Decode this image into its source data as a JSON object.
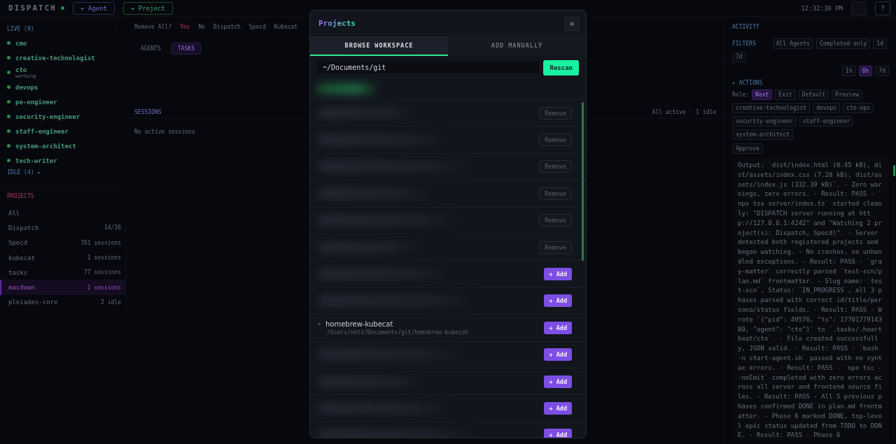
{
  "topbar": {
    "logo": "DISPATCH",
    "buttons": [
      {
        "label": "+ Agent",
        "kind": "agent"
      },
      {
        "label": "+ Project",
        "kind": "project"
      }
    ],
    "clock": "12:32:38 PM",
    "help": "?"
  },
  "sidebar": {
    "live_header": "LIVE (9)",
    "agents": [
      {
        "name": "cmo"
      },
      {
        "name": "creative-technologist"
      },
      {
        "name": "cto",
        "status": "working"
      },
      {
        "name": "devops"
      },
      {
        "name": "pe-engineer"
      },
      {
        "name": "security-engineer"
      },
      {
        "name": "staff-engineer"
      },
      {
        "name": "system-architect"
      },
      {
        "name": "tech-writer"
      }
    ],
    "idle_toggle": "IDLE (4) ▸",
    "projects_header": "PROJECTS",
    "projects": [
      {
        "name": "All",
        "selected": false
      },
      {
        "name": "Dispatch",
        "meta": "14/36",
        "selected": false
      },
      {
        "name": "Specd",
        "meta": "761 sessions",
        "selected": false
      },
      {
        "name": "kubecat",
        "meta": "1 sessions",
        "selected": false
      },
      {
        "name": "tasks",
        "meta": "77 sessions",
        "selected": false
      },
      {
        "name": "macdown",
        "meta": "1 sessions",
        "selected": true
      },
      {
        "name": "pleiades-core",
        "meta": "2 idle",
        "selected": false
      }
    ]
  },
  "center": {
    "filter_bar": {
      "prompt": "Remove All?",
      "confirm": "Yes",
      "cancel": "No",
      "projects": [
        "Dispatch",
        "Specd",
        "Kubecat"
      ]
    },
    "view_tabs": [
      {
        "label": "AGENTS",
        "selected": false
      },
      {
        "label": "TASKS",
        "selected": true
      }
    ],
    "sessions": {
      "title": "SESSIONS",
      "summary": "All active · 1 idle",
      "empty": "No active sessions"
    }
  },
  "activity": {
    "title": "ACTIVITY",
    "filters_label": "FILTERS",
    "filter_chips": [
      "All Agents",
      "Completed only",
      "1d",
      "7d"
    ],
    "ranges": [
      {
        "label": "1h",
        "selected": false
      },
      {
        "label": "6h",
        "selected": true
      },
      {
        "label": "7d",
        "selected": false
      }
    ],
    "actions_label": "▸ ACTIONS",
    "role_label": "Role:",
    "roles": [
      {
        "label": "Next",
        "selected": true
      },
      {
        "label": "Exit",
        "selected": false
      },
      {
        "label": "Default",
        "selected": false
      },
      {
        "label": "Preview",
        "selected": false
      }
    ],
    "agent_chips": [
      "creative-technologist",
      "devops",
      "cto-ops",
      "security-engineer",
      "staff-engineer",
      "system-architect"
    ],
    "section": "Approve",
    "log": "Output: `dist/index.html (0.45 kB), dist/assets/index.css (7.28 kB), dist/assets/index.js (332.39 kB)`. - Zero warnings, zero errors. - Result: PASS - `npx tsx server/index.ts` started cleanly: \"DISPATCH server running at http://127.0.0.1:4242\" and \"Watching 2 project(s): Dispatch, Specd)\". - Server detected both registered projects and began watching. - No crashes, no unhandled exceptions. - Result: PASS - `gray-matter` correctly parsed `test-scn/plan.md` frontmatter. - Slug name: `test-scn`, Status: `IN_PROGRESS`, all 3 phases parsed with correct id/title/persona/status fields. - Result: PASS - Wrote `{\"pid\": 49576, \"ts\": 1770177914380, \"agent\": \"cto\"}` to `.tasks/.heartbeat/cto`. - File created successfully, JSON valid. - Result: PASS - `bash -n start-agent.sh` passed with no syntax errors. - Result: PASS - `npx tsc --noEmit` completed with zero errors across all server and frontend source files. - Result: PASS - All 5 previous phases confirmed DONE in plan.md frontmatter. - Phase 6 marked DONE, top-level epic status updated from TODO to DONE. - Result: PASS - Phase 6"
  },
  "modal": {
    "title": "Projects",
    "close": "×",
    "tabs": [
      {
        "label": "BROWSE WORKSPACE",
        "selected": true
      },
      {
        "label": "ADD MANUALLY",
        "selected": false
      }
    ],
    "path": "~/Documents/git",
    "rescan": "Rescan",
    "rows": [
      {
        "kind": "remove",
        "redacted": true,
        "action": "Remove"
      },
      {
        "kind": "remove",
        "redacted": true,
        "action": "Remove"
      },
      {
        "kind": "remove",
        "redacted": true,
        "action": "Remove"
      },
      {
        "kind": "remove",
        "redacted": true,
        "action": "Remove"
      },
      {
        "kind": "remove",
        "redacted": true,
        "action": "Remove"
      },
      {
        "kind": "remove",
        "redacted": true,
        "action": "Remove"
      },
      {
        "kind": "add",
        "redacted": true,
        "action": "+ Add"
      },
      {
        "kind": "add",
        "redacted": true,
        "action": "+ Add"
      },
      {
        "kind": "add",
        "redacted": false,
        "name": "homebrew-kubecat",
        "path": "/Users/netz/Documents/git/homebrew-kubecat",
        "action": "+ Add"
      },
      {
        "kind": "add",
        "redacted": true,
        "action": "+ Add"
      },
      {
        "kind": "add",
        "redacted": true,
        "action": "+ Add"
      },
      {
        "kind": "add",
        "redacted": true,
        "action": "+ Add"
      },
      {
        "kind": "add",
        "redacted": true,
        "action": "+ Add"
      }
    ]
  }
}
